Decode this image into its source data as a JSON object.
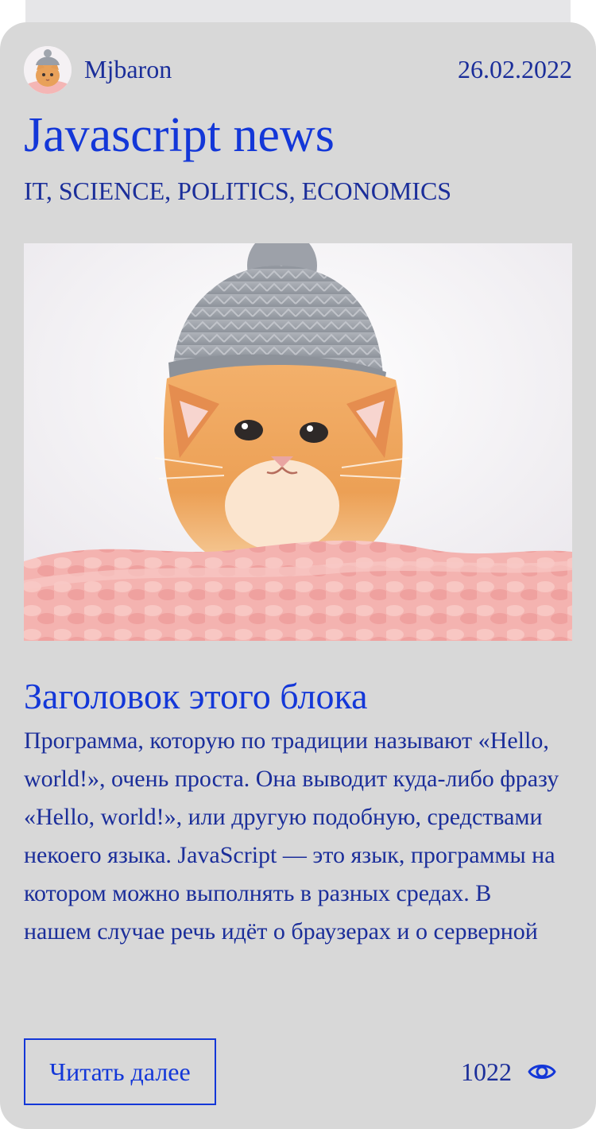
{
  "post": {
    "author": "Mjbaron",
    "date": "26.02.2022",
    "title": "Javascript news",
    "tags": "IT, SCIENCE, POLITICS, ECONOMICS",
    "block_heading": "Заголовок этого блока",
    "block_text": "Программа, которую по традиции называют «Hello, world!», очень проста. Она выводит куда-либо фразу «Hello, world!», или другую подобную, средствами некоего языка. JavaScript — это язык, программы на котором можно выполнять в разных средах. В нашем случае речь идёт о браузерах и о серверной",
    "read_more_label": "Читать далее",
    "views_count": "1022"
  },
  "icons": {
    "views": "eye-icon"
  },
  "colors": {
    "card_background": "#d8d8d8",
    "primary_blue": "#1337d8",
    "text_blue": "#1b2e9a"
  }
}
